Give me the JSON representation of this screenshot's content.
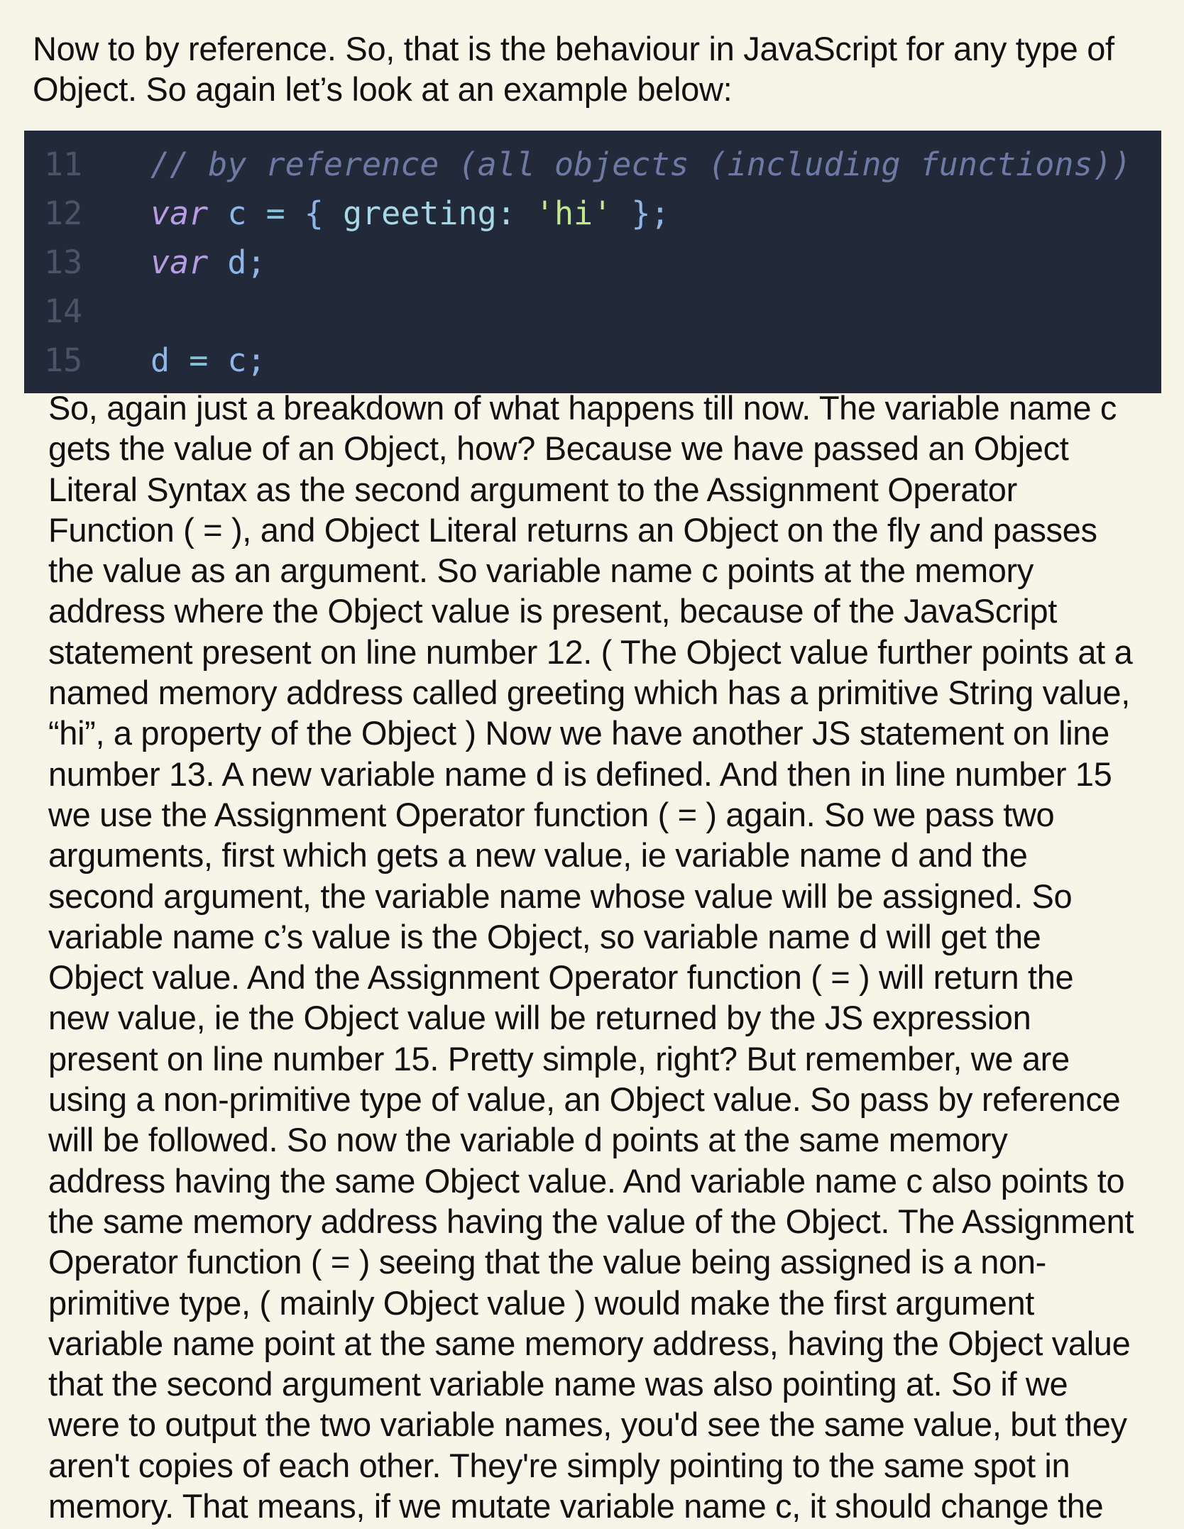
{
  "intro": {
    "lines": [
      "Now to by reference. So, that is the behaviour in JavaScript for any type of",
      "Object. So again let’s look at an example below:"
    ]
  },
  "code": {
    "lines": [
      {
        "number": "11",
        "tokens": [
          {
            "type": "comment",
            "text": "// by reference (all objects (including functions))"
          }
        ]
      },
      {
        "number": "12",
        "tokens": [
          {
            "type": "keyword",
            "text": "var"
          },
          {
            "type": "plain",
            "text": " "
          },
          {
            "type": "ident",
            "text": "c"
          },
          {
            "type": "plain",
            "text": " "
          },
          {
            "type": "op",
            "text": "="
          },
          {
            "type": "plain",
            "text": " "
          },
          {
            "type": "punc",
            "text": "{"
          },
          {
            "type": "plain",
            "text": " "
          },
          {
            "type": "key",
            "text": "greeting:"
          },
          {
            "type": "plain",
            "text": " "
          },
          {
            "type": "string",
            "text": "'hi'"
          },
          {
            "type": "plain",
            "text": " "
          },
          {
            "type": "punc",
            "text": "};"
          }
        ]
      },
      {
        "number": "13",
        "tokens": [
          {
            "type": "keyword",
            "text": "var"
          },
          {
            "type": "plain",
            "text": " "
          },
          {
            "type": "ident",
            "text": "d;"
          }
        ]
      },
      {
        "number": "14",
        "tokens": []
      },
      {
        "number": "15",
        "tokens": [
          {
            "type": "ident",
            "text": "d"
          },
          {
            "type": "plain",
            "text": " "
          },
          {
            "type": "op",
            "text": "="
          },
          {
            "type": "plain",
            "text": " "
          },
          {
            "type": "ident",
            "text": "c;"
          }
        ]
      }
    ]
  },
  "body": {
    "lines": [
      "So, again just a breakdown of what happens till now. The variable name c",
      "gets the value of an Object, how? Because we have passed an Object",
      "Literal Syntax as the second argument to the Assignment Operator",
      "Function ( = ), and Object Literal returns an Object on the fly and passes",
      "the value as an argument. So variable name c points at the memory",
      "address where the Object value is present, because of the JavaScript",
      "statement present on line number 12. ( The Object value further points at a",
      "named memory address called greeting which has a primitive String value,",
      "“hi”, a property of the Object ) Now we have another JS statement on line",
      "number 13. A new variable name d is defined. And then in line number 15",
      "we use the Assignment Operator function ( = ) again. So we pass two",
      "arguments, first which gets a new value, ie variable name d and the",
      "second argument, the variable name whose value will be assigned. So",
      "variable name c’s value is the Object, so variable name d will get the",
      "Object value. And the Assignment Operator function ( = ) will return the",
      "new value, ie the Object value will be returned by the JS expression",
      "present on line number 15. Pretty simple, right? But remember, we are",
      "using a non-primitive type of value, an Object value. So pass by reference",
      "will be followed. So now the variable d points at the same memory",
      "address having the same Object value. And variable name c also points to",
      "the same memory address having the value of the Object. The Assignment",
      "Operator function ( = ) seeing that the value being assigned is a non-",
      "primitive type, ( mainly Object value ) would make the first argument",
      "variable name point at the same memory address, having the Object value",
      "that the second argument variable name was also pointing at. So if we",
      "were to output the two variable names, you'd see the same value, but they",
      "aren't copies of each other. They're simply pointing to the same spot in",
      "memory. That means, if we mutate variable name c, it should change the"
    ]
  }
}
